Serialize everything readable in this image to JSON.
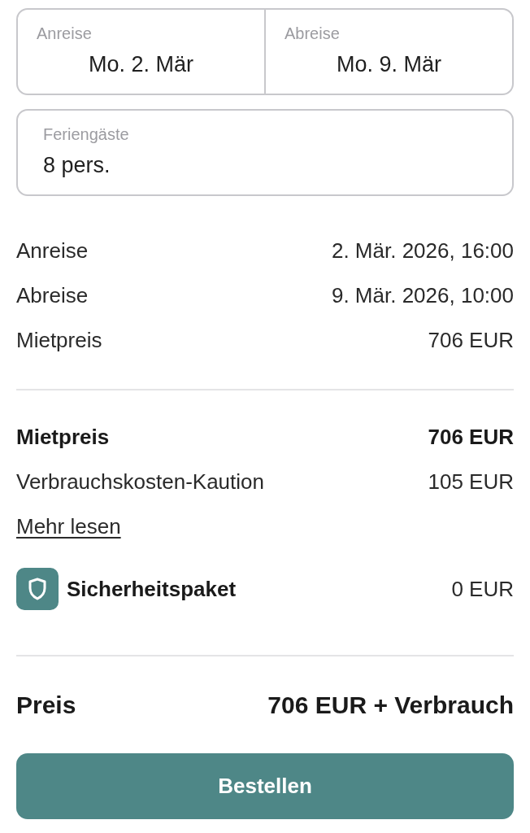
{
  "dates": [
    {
      "label": "Anreise",
      "value": "Mo. 2. Mär"
    },
    {
      "label": "Abreise",
      "value": "Mo. 9. Mär"
    }
  ],
  "guests": {
    "label": "Feriengäste",
    "value": "8 pers."
  },
  "details": [
    {
      "label": "Anreise",
      "value": "2. Mär. 2026, 16:00"
    },
    {
      "label": "Abreise",
      "value": "9. Mär. 2026, 10:00"
    },
    {
      "label": "Mietpreis",
      "value": "706 EUR"
    }
  ],
  "summary": [
    {
      "kind": "bold",
      "label": "Mietpreis",
      "value": "706 EUR"
    },
    {
      "kind": "plain",
      "label": "Verbrauchskosten-Kaution",
      "value": "105 EUR"
    },
    {
      "kind": "link",
      "label": "Mehr lesen"
    },
    {
      "kind": "package",
      "label": "Sicherheitspaket",
      "value": "0 EUR"
    }
  ],
  "total": {
    "label": "Preis",
    "value": "706 EUR + Verbrauch"
  },
  "order_button": "Bestellen"
}
